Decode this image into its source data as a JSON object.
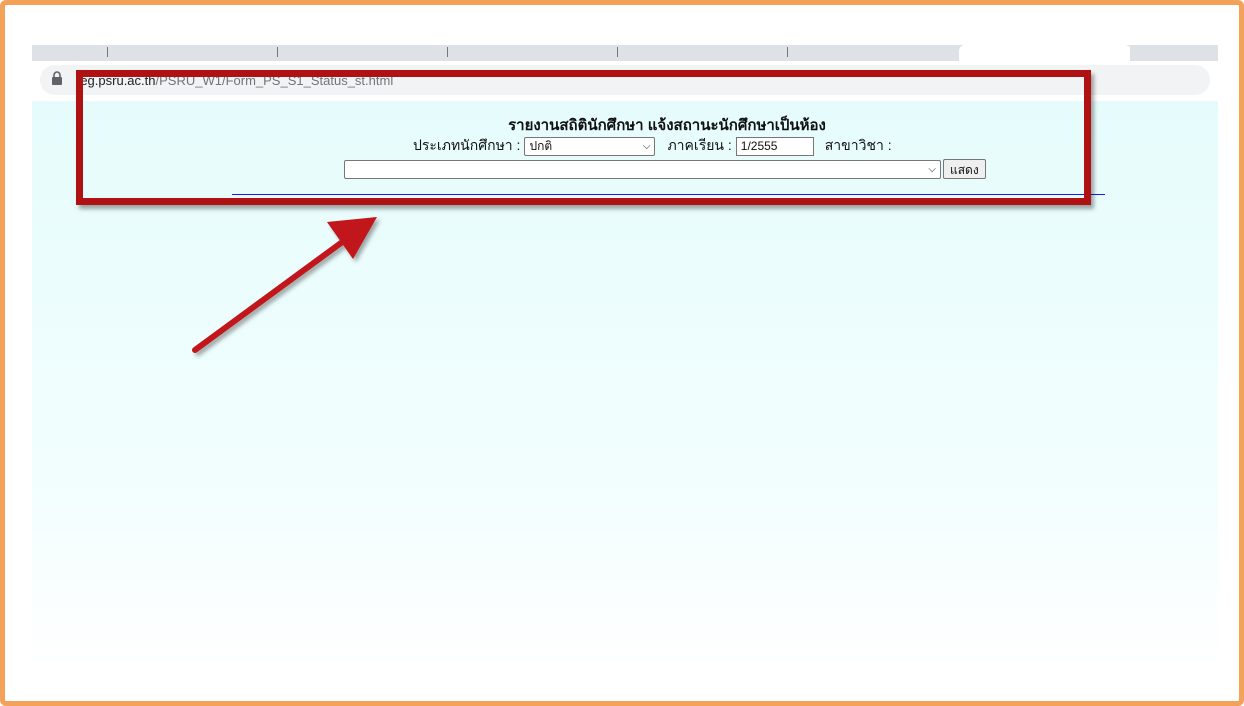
{
  "browser": {
    "url_host": "reg.psru.ac.th",
    "url_path": "/PSRU_W1/Form_PS_S1_Status_st.html"
  },
  "page": {
    "title": "รายงานสถิตินักศึกษา แจ้งสถานะนักศึกษาเป็นห้อง",
    "student_type_label": "ประเภทนักศึกษา :",
    "student_type_value": "ปกติ",
    "semester_label": "ภาคเรียน :",
    "semester_value": "1/2555",
    "major_label": "สาขาวิชา :",
    "major_value": "",
    "show_button": "แสดง"
  },
  "annotation": {
    "box_color": "#b01214",
    "arrow_color": "#c0161a"
  },
  "colors": {
    "frame": "#f4a259",
    "divider": "#1a1aff"
  }
}
